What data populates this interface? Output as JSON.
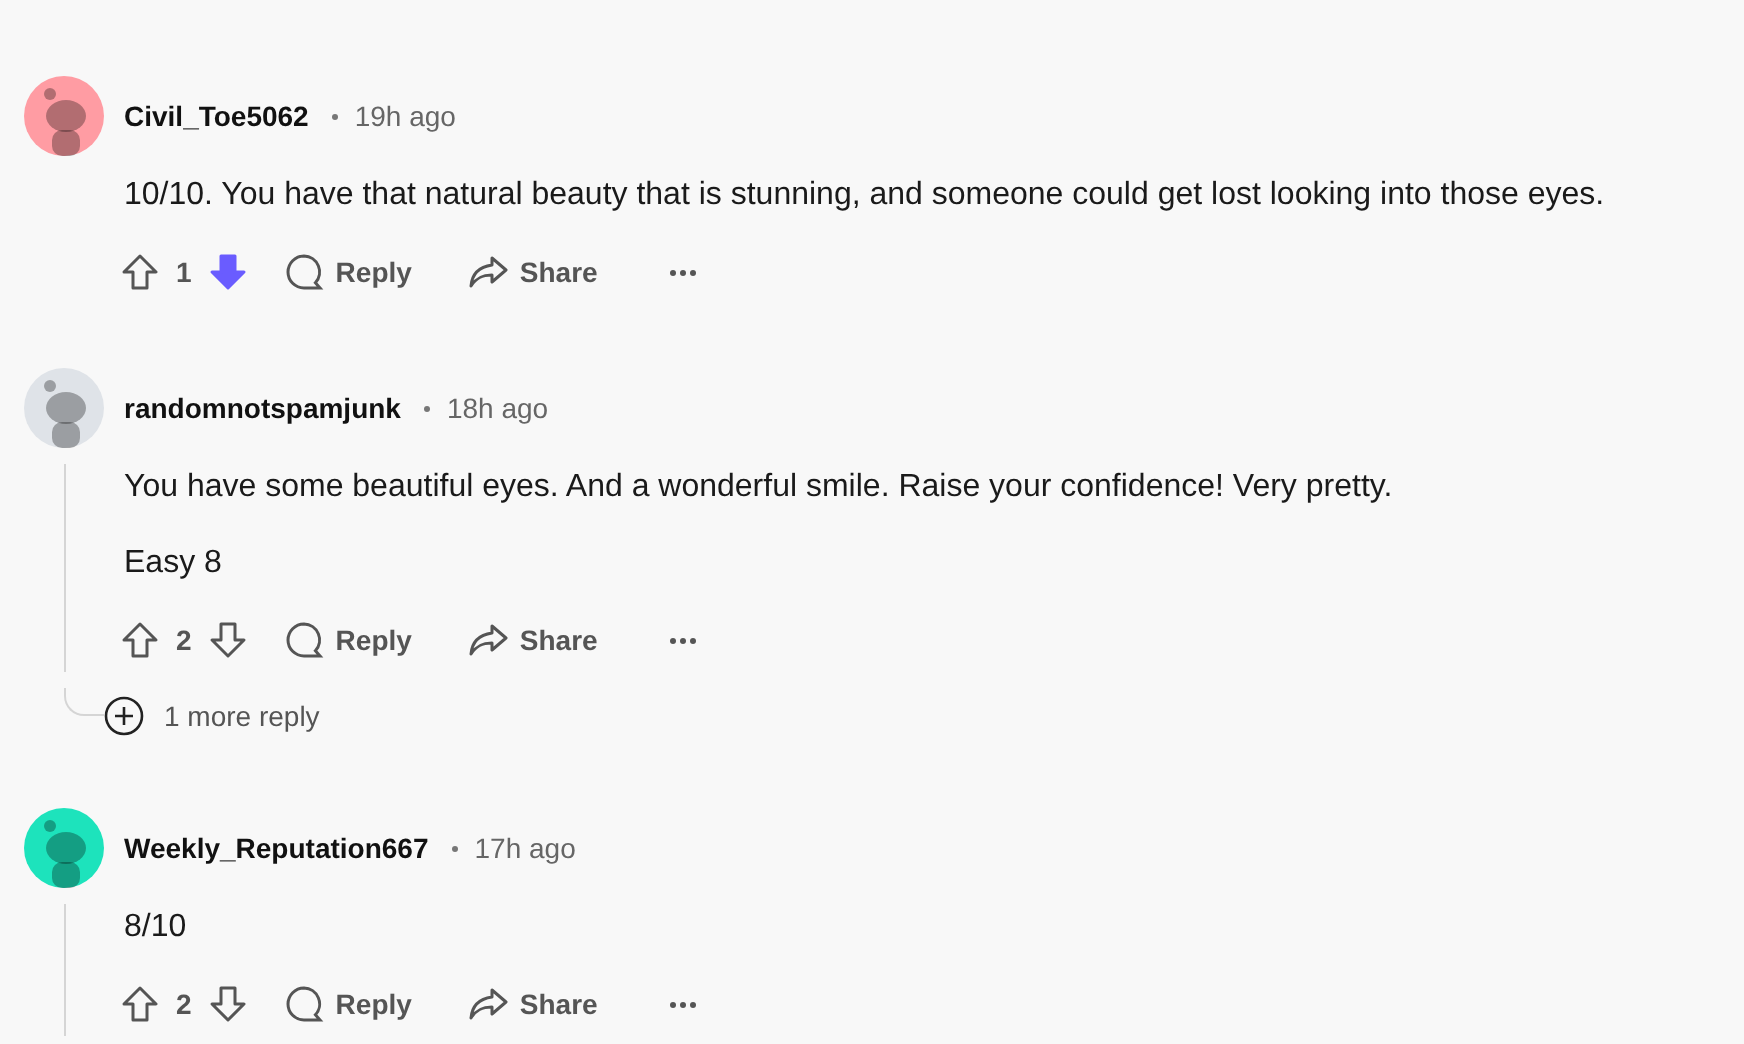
{
  "comments": [
    {
      "author": "Civil_Toe5062",
      "time": "19h ago",
      "color": "#ff9ca3",
      "paragraphs": [
        "10/10. You have that natural beauty that is stunning, and someone could get lost looking into those eyes."
      ],
      "score": "1",
      "downvoted": true,
      "reply": "Reply",
      "share": "Share",
      "thread_line": false
    },
    {
      "author": "randomnotspamjunk",
      "time": "18h ago",
      "color": "#dfe3e8",
      "paragraphs": [
        "You have some beautiful eyes. And a wonderful smile. Raise your confidence! Very pretty.",
        "Easy 8"
      ],
      "score": "2",
      "downvoted": false,
      "reply": "Reply",
      "share": "Share",
      "thread_line": true,
      "more_replies": "1 more reply"
    },
    {
      "author": "Weekly_Reputation667",
      "time": "17h ago",
      "color": "#1de3bc",
      "paragraphs": [
        "8/10"
      ],
      "score": "2",
      "downvoted": false,
      "reply": "Reply",
      "share": "Share",
      "thread_line": true
    }
  ]
}
